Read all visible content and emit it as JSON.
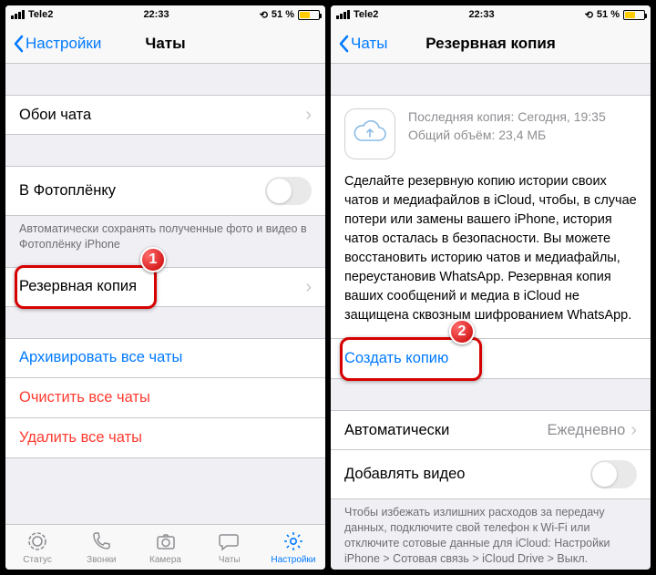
{
  "status": {
    "carrier": "Tele2",
    "time": "22:33",
    "battery_pct": "51 %",
    "battery_fill_pct": 51
  },
  "left": {
    "nav_back": "Настройки",
    "nav_title": "Чаты",
    "wallpaper": "Обои чата",
    "camera_roll": "В Фотоплёнку",
    "camera_roll_note": "Автоматически сохранять полученные фото и видео в Фотоплёнку iPhone",
    "backup": "Резервная копия",
    "archive_all": "Архивировать все чаты",
    "clear_all": "Очистить все чаты",
    "delete_all": "Удалить все чаты",
    "tabs": {
      "status": "Статус",
      "calls": "Звонки",
      "camera": "Камера",
      "chats": "Чаты",
      "settings": "Настройки"
    },
    "callout_number": "1"
  },
  "right": {
    "nav_back": "Чаты",
    "nav_title": "Резервная копия",
    "last_backup_label": "Последняя копия: Сегодня, 19:35",
    "size_label": "Общий объём: 23,4 МБ",
    "description": "Сделайте резервную копию истории своих чатов и медиафайлов в iCloud, чтобы, в случае потери или замены вашего iPhone, история чатов осталась в безопасности. Вы можете восстановить историю чатов и медиафайлы, переустановив WhatsApp. Резервная копия ваших сообщений и медиа в iCloud не защищена сквозным шифрованием WhatsApp.",
    "create_backup": "Создать копию",
    "auto_label": "Автоматически",
    "auto_value": "Ежедневно",
    "include_video": "Добавлять видео",
    "footer_note": "Чтобы избежать излишних расходов за передачу данных, подключите свой телефон к Wi-Fi или отключите сотовые данные для iCloud: Настройки iPhone > Сотовая связь > iCloud Drive > Выкл.",
    "callout_number": "2"
  }
}
